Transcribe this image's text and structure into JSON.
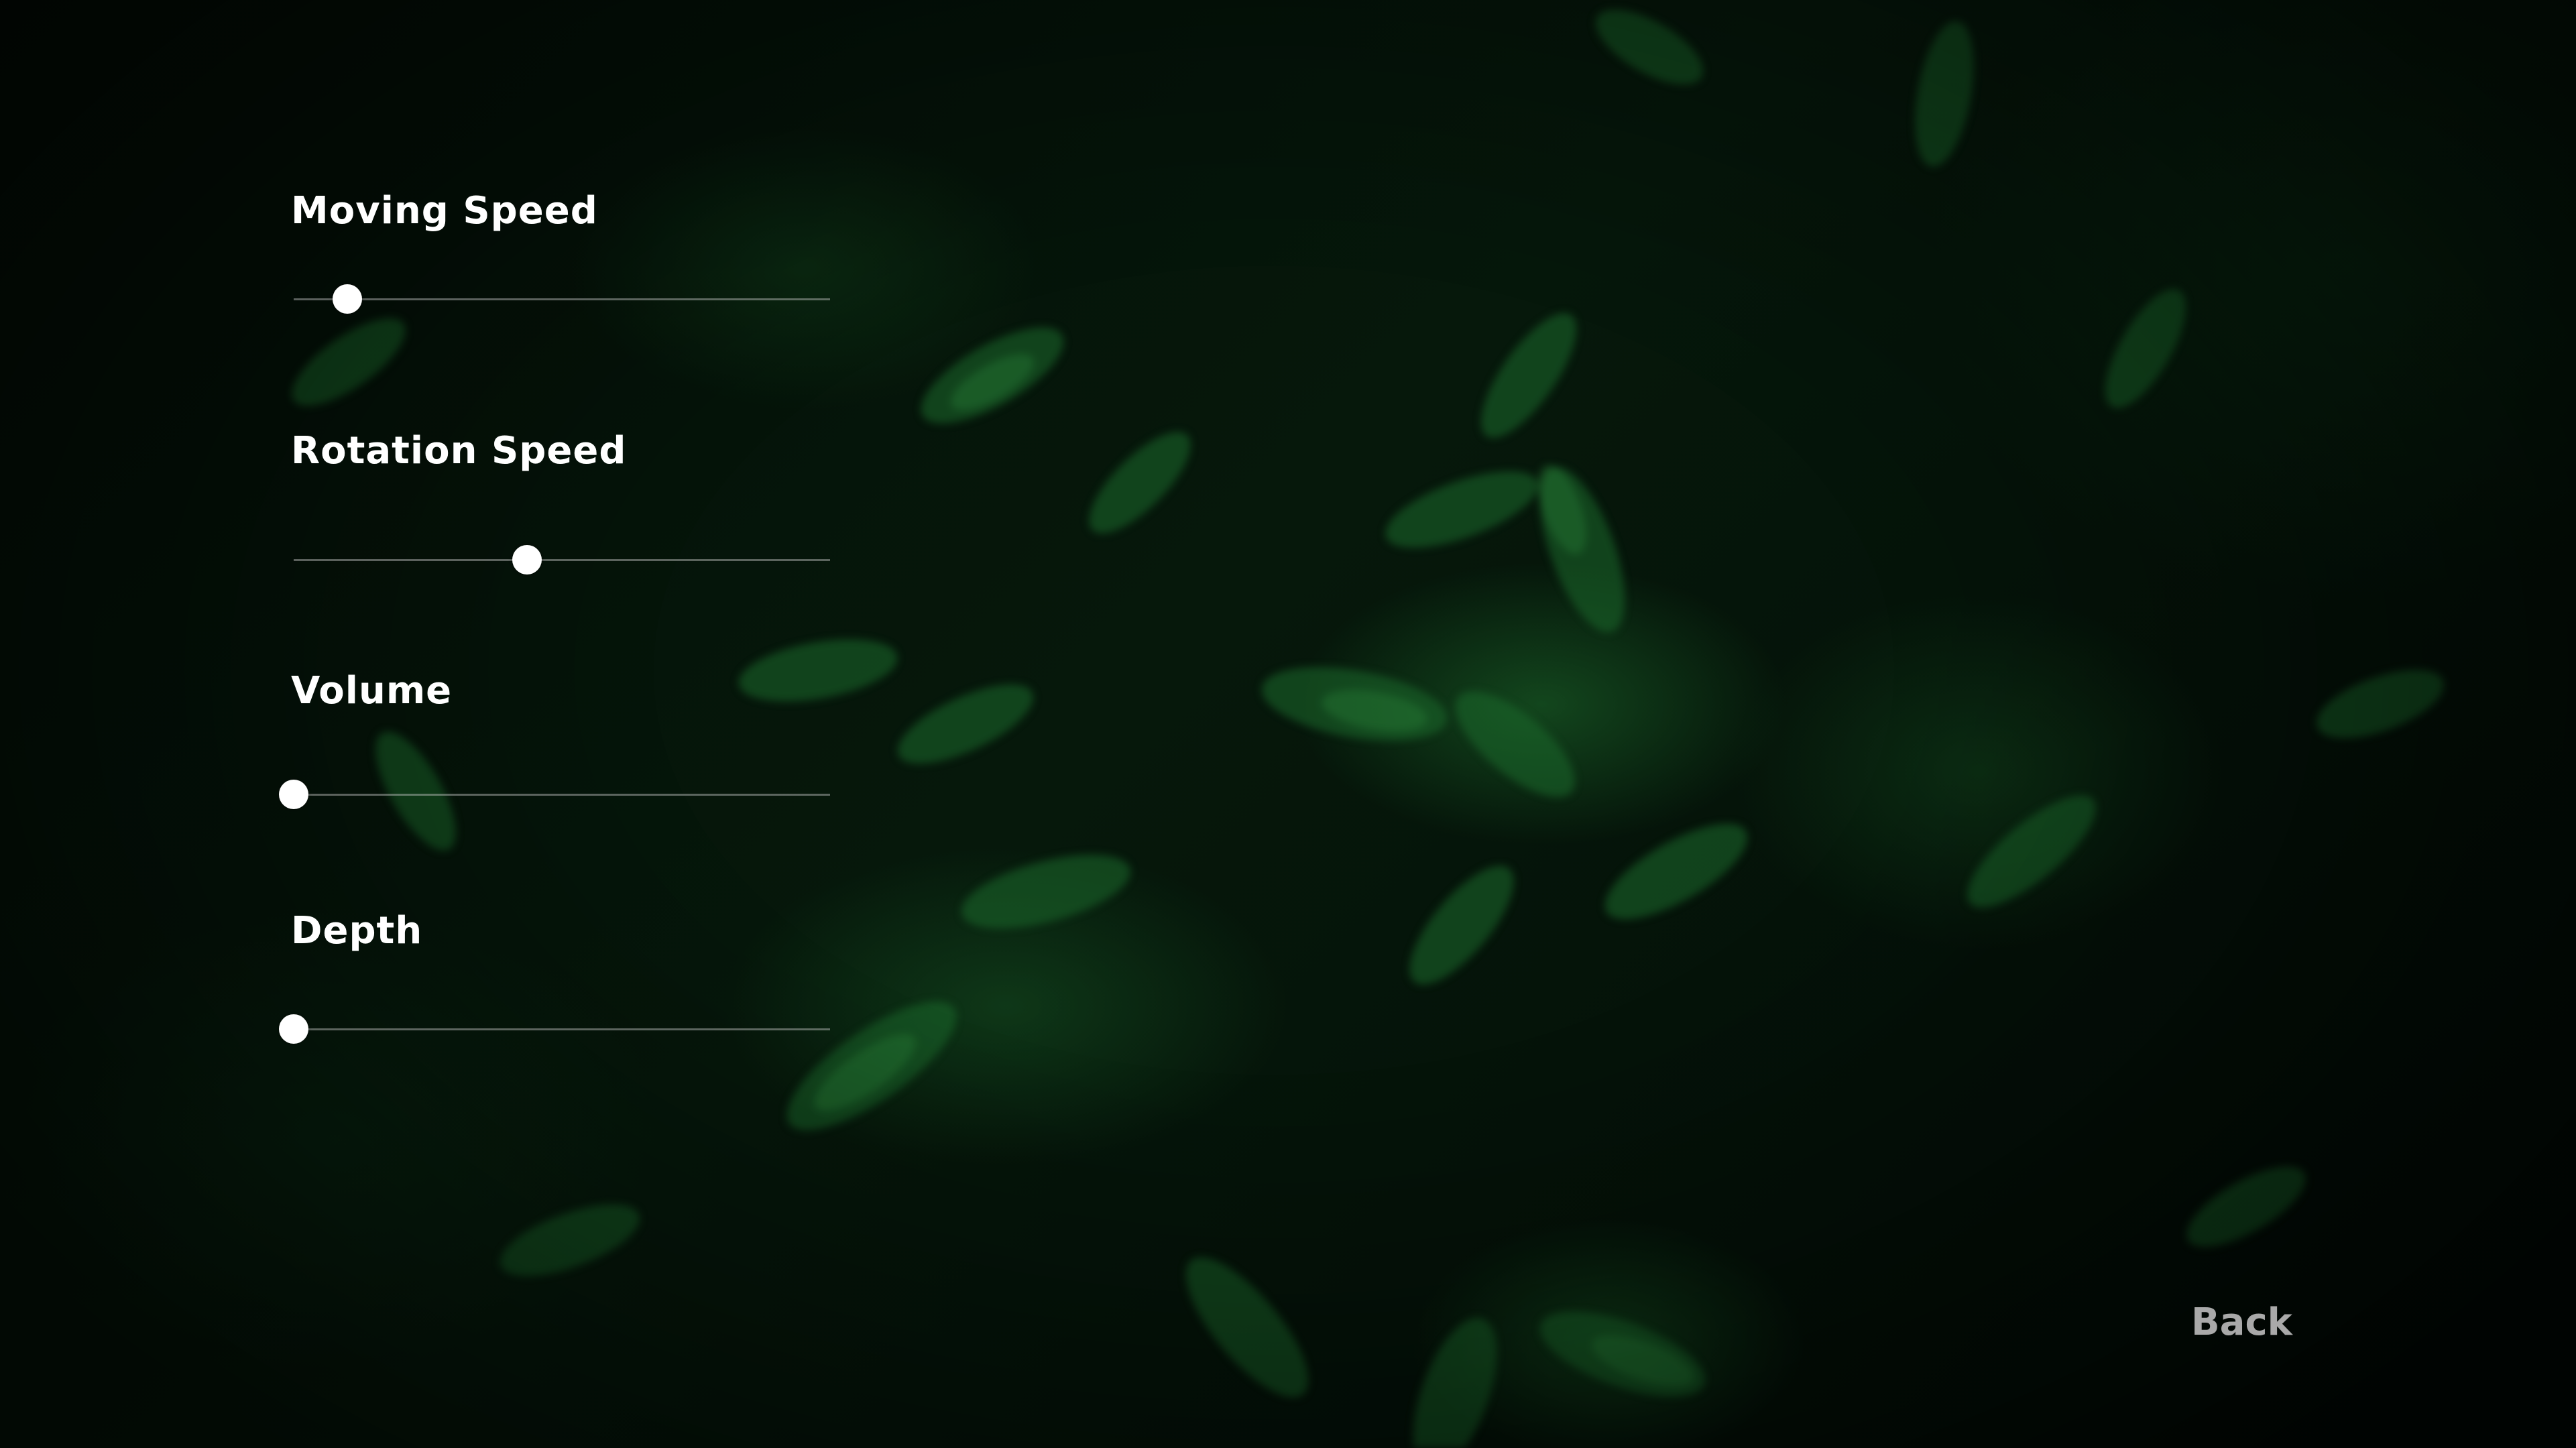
{
  "settings": [
    {
      "label": "Moving Speed",
      "value": 0.1
    },
    {
      "label": "Rotation Speed",
      "value": 0.435
    },
    {
      "label": "Volume",
      "value": 0.0
    },
    {
      "label": "Depth",
      "value": 0.0
    }
  ],
  "back_label": "Back",
  "colors": {
    "label_text": "#ffffff",
    "back_text": "#a9a9a9",
    "thumb": "#ffffff",
    "background": "#041108",
    "foliage": "#1e6e2d"
  }
}
